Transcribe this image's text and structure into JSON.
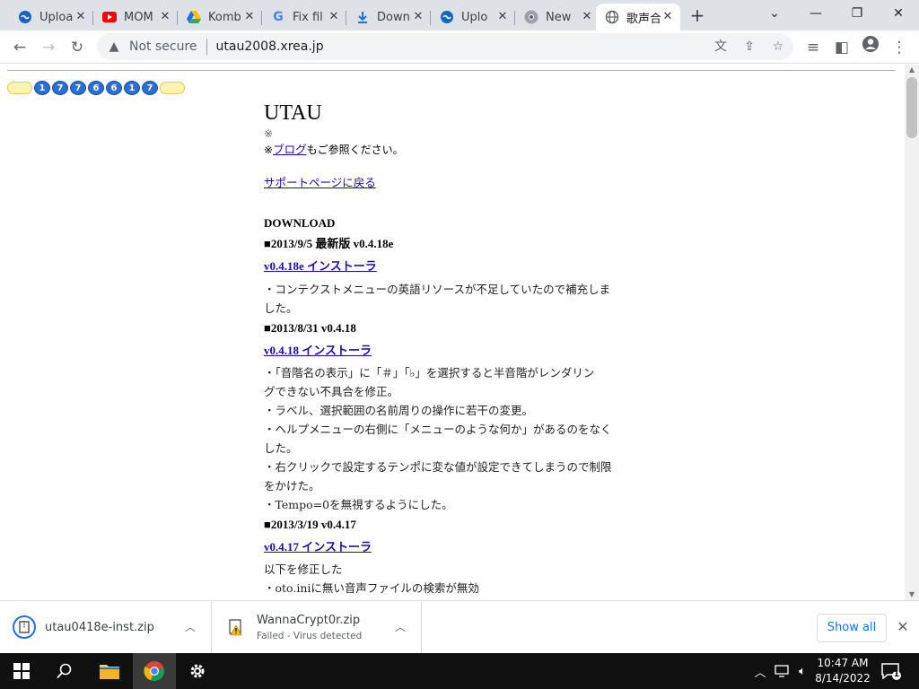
{
  "browser": {
    "tabs": [
      {
        "title": "Uploa",
        "icon": "upload-icon",
        "active": false
      },
      {
        "title": "MOM",
        "icon": "youtube-icon",
        "active": false
      },
      {
        "title": "Komb",
        "icon": "google-drive-icon",
        "active": false
      },
      {
        "title": "Fix fil",
        "icon": "google-icon",
        "active": false
      },
      {
        "title": "Down",
        "icon": "download-icon",
        "active": false
      },
      {
        "title": "Uplo",
        "icon": "upload-icon",
        "active": false
      },
      {
        "title": "New",
        "icon": "chrome-icon",
        "active": false
      },
      {
        "title": "歌声合",
        "icon": "globe-icon",
        "active": true
      }
    ],
    "security_label": "Not secure",
    "url": "utau2008.xrea.jp"
  },
  "page": {
    "counter_digits": [
      "1",
      "7",
      "7",
      "6",
      "6",
      "1",
      "7"
    ],
    "title": "UTAU",
    "note1": "※",
    "note2_prefix": "※",
    "note2_link": "ブログ",
    "note2_suffix": "もご参照ください。",
    "support_link": "サポートページに戻る",
    "download_heading": "DOWNLOAD",
    "releases": [
      {
        "date": "■2013/9/5 最新版 v0.4.18e",
        "link": "v0.4.18e インストーラ",
        "notes": [
          "・コンテクストメニューの英語リソースが不足していたので補充しま",
          "した。"
        ]
      },
      {
        "date": "■2013/8/31 v0.4.18",
        "link": "v0.4.18 インストーラ",
        "notes": [
          "・「音階名の表示」に「＃」「♭」を選択すると半音階がレンダリン",
          "グできない不具合を修正。",
          "・ラベル、選択範囲の名前周りの操作に若干の変更。",
          "・ヘルプメニューの右側に「メニューのような何か」があるのをなく",
          "した。",
          "・右クリックで設定するテンポに変な値が設定できてしまうので制限",
          "をかけた。",
          "・Tempo=0を無視するようにした。"
        ]
      },
      {
        "date": "■2013/3/19 v0.4.17",
        "link": "v0.4.17 インストーラ",
        "notes": [
          "以下を修正した",
          "・oto.iniに無い音声ファイルの検索が無効"
        ]
      }
    ]
  },
  "downloads": {
    "items": [
      {
        "name": "utau0418e-inst.zip",
        "status": "",
        "icon": "zip-file-icon"
      },
      {
        "name": "WannaCrypt0r.zip",
        "status": "Failed - Virus detected",
        "icon": "warning-file-icon"
      }
    ],
    "show_all_label": "Show all"
  },
  "taskbar": {
    "time": "10:47 AM",
    "date": "8/14/2022",
    "notification_count": "1"
  }
}
